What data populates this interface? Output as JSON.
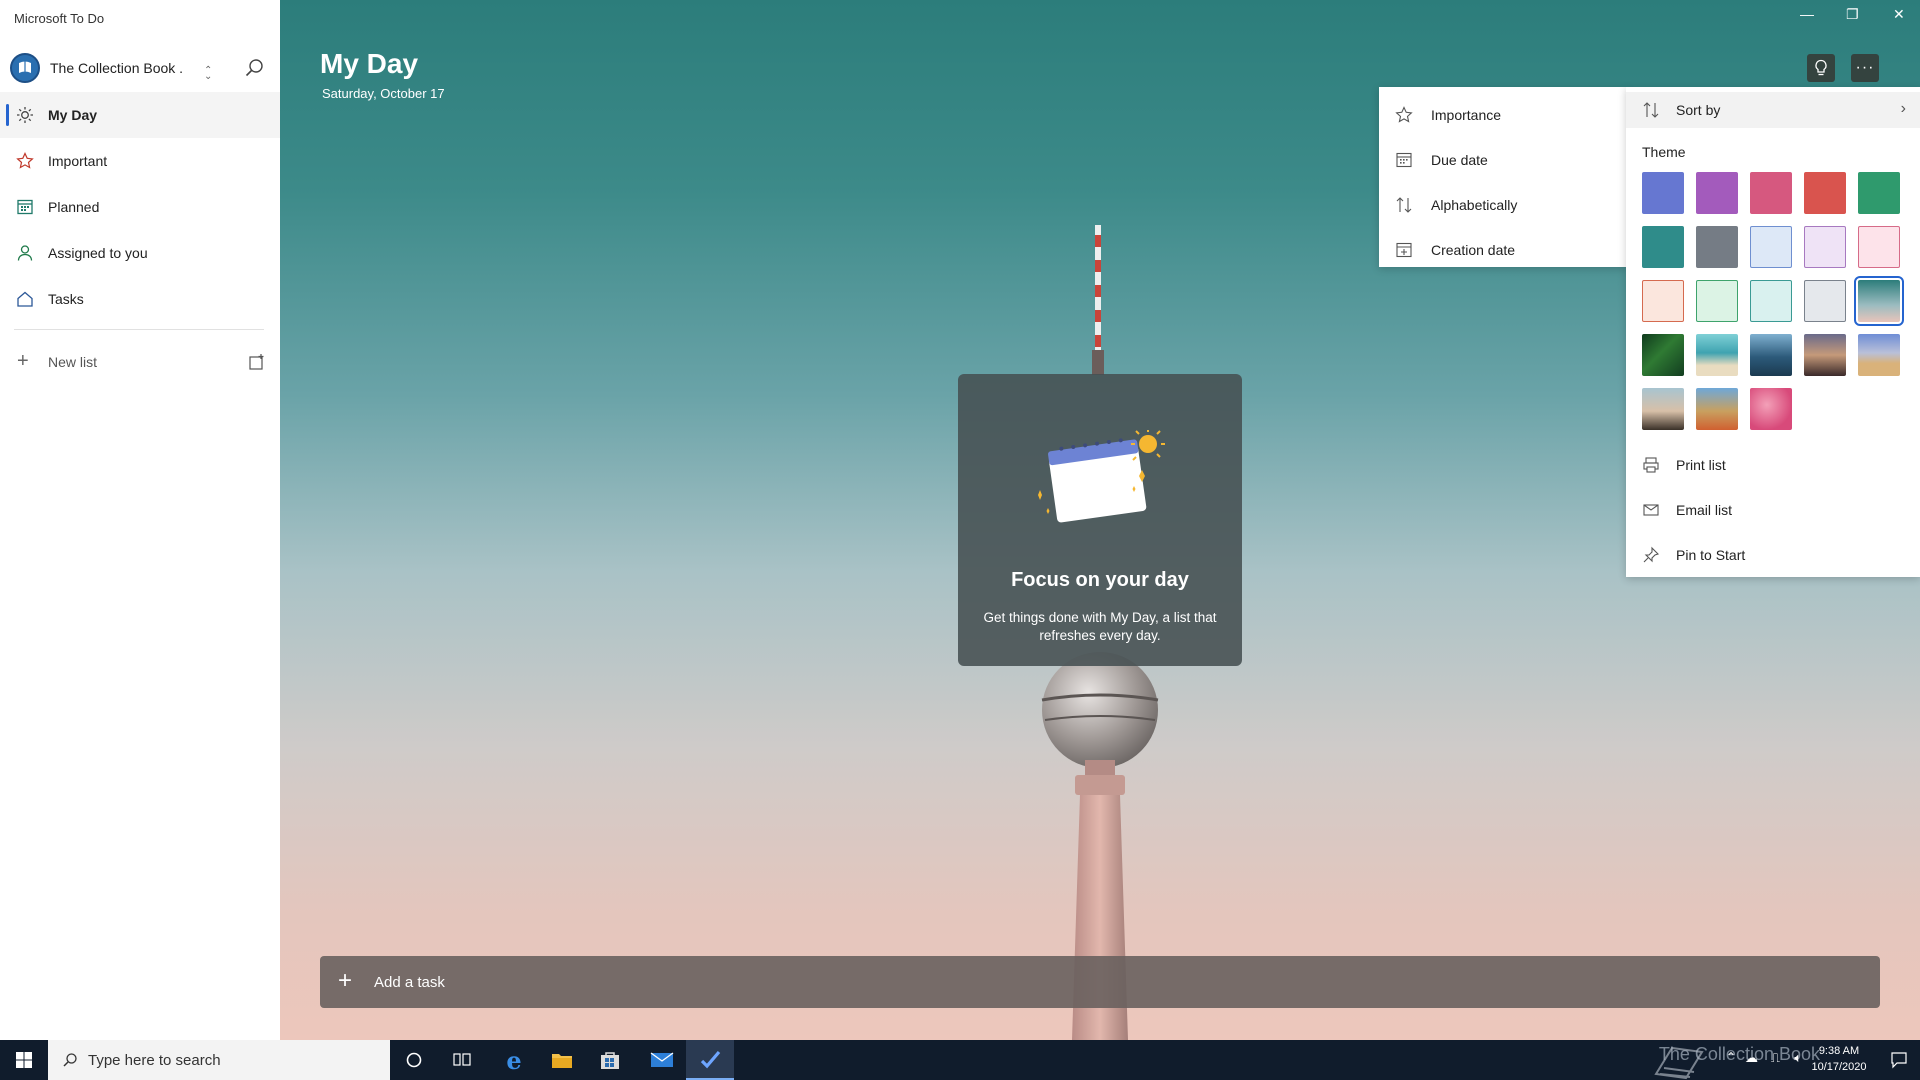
{
  "app": {
    "title": "Microsoft To Do"
  },
  "sidebar": {
    "account_name": "The Collection Book .",
    "nav_items": [
      {
        "label": "My Day",
        "icon": "sun-icon",
        "active": true
      },
      {
        "label": "Important",
        "icon": "star-icon"
      },
      {
        "label": "Planned",
        "icon": "calendar-icon"
      },
      {
        "label": "Assigned to you",
        "icon": "person-icon"
      },
      {
        "label": "Tasks",
        "icon": "home-icon"
      }
    ],
    "new_list_label": "New list"
  },
  "main": {
    "title": "My Day",
    "date": "Saturday, October 17",
    "focus_card": {
      "title": "Focus on your day",
      "description": "Get things done with My Day, a list that refreshes every day."
    },
    "add_task_label": "Add a task"
  },
  "sort_menu": {
    "items": [
      {
        "label": "Importance",
        "icon": "star-outline-icon"
      },
      {
        "label": "Due date",
        "icon": "calendar-icon"
      },
      {
        "label": "Alphabetically",
        "icon": "sort-arrows-icon"
      },
      {
        "label": "Creation date",
        "icon": "calendar-add-icon"
      }
    ]
  },
  "options_menu": {
    "sort_by_label": "Sort by",
    "theme_label": "Theme",
    "theme_colors": [
      "#6677d1",
      "#a35bbc",
      "#d6587f",
      "#d9544e",
      "#2f9a6d",
      "#2f8c8a",
      "#757c85",
      "#dde8f7",
      "#efe3f6",
      "#fde3ea",
      "#fbe6dd",
      "#dcf3e5",
      "#d9f1ef",
      "#e5e8ec",
      "photo-tower",
      "photo-leaves",
      "photo-beach",
      "photo-mountains",
      "photo-palm",
      "photo-desert",
      "photo-lighthouse",
      "photo-field",
      "photo-pink"
    ],
    "selected_theme": "photo-tower",
    "print_label": "Print list",
    "email_label": "Email list",
    "pin_label": "Pin to Start"
  },
  "taskbar": {
    "search_placeholder": "Type here to search",
    "time": "9:38 AM",
    "date": "10/17/2020",
    "watermark": "The Collection Book"
  }
}
